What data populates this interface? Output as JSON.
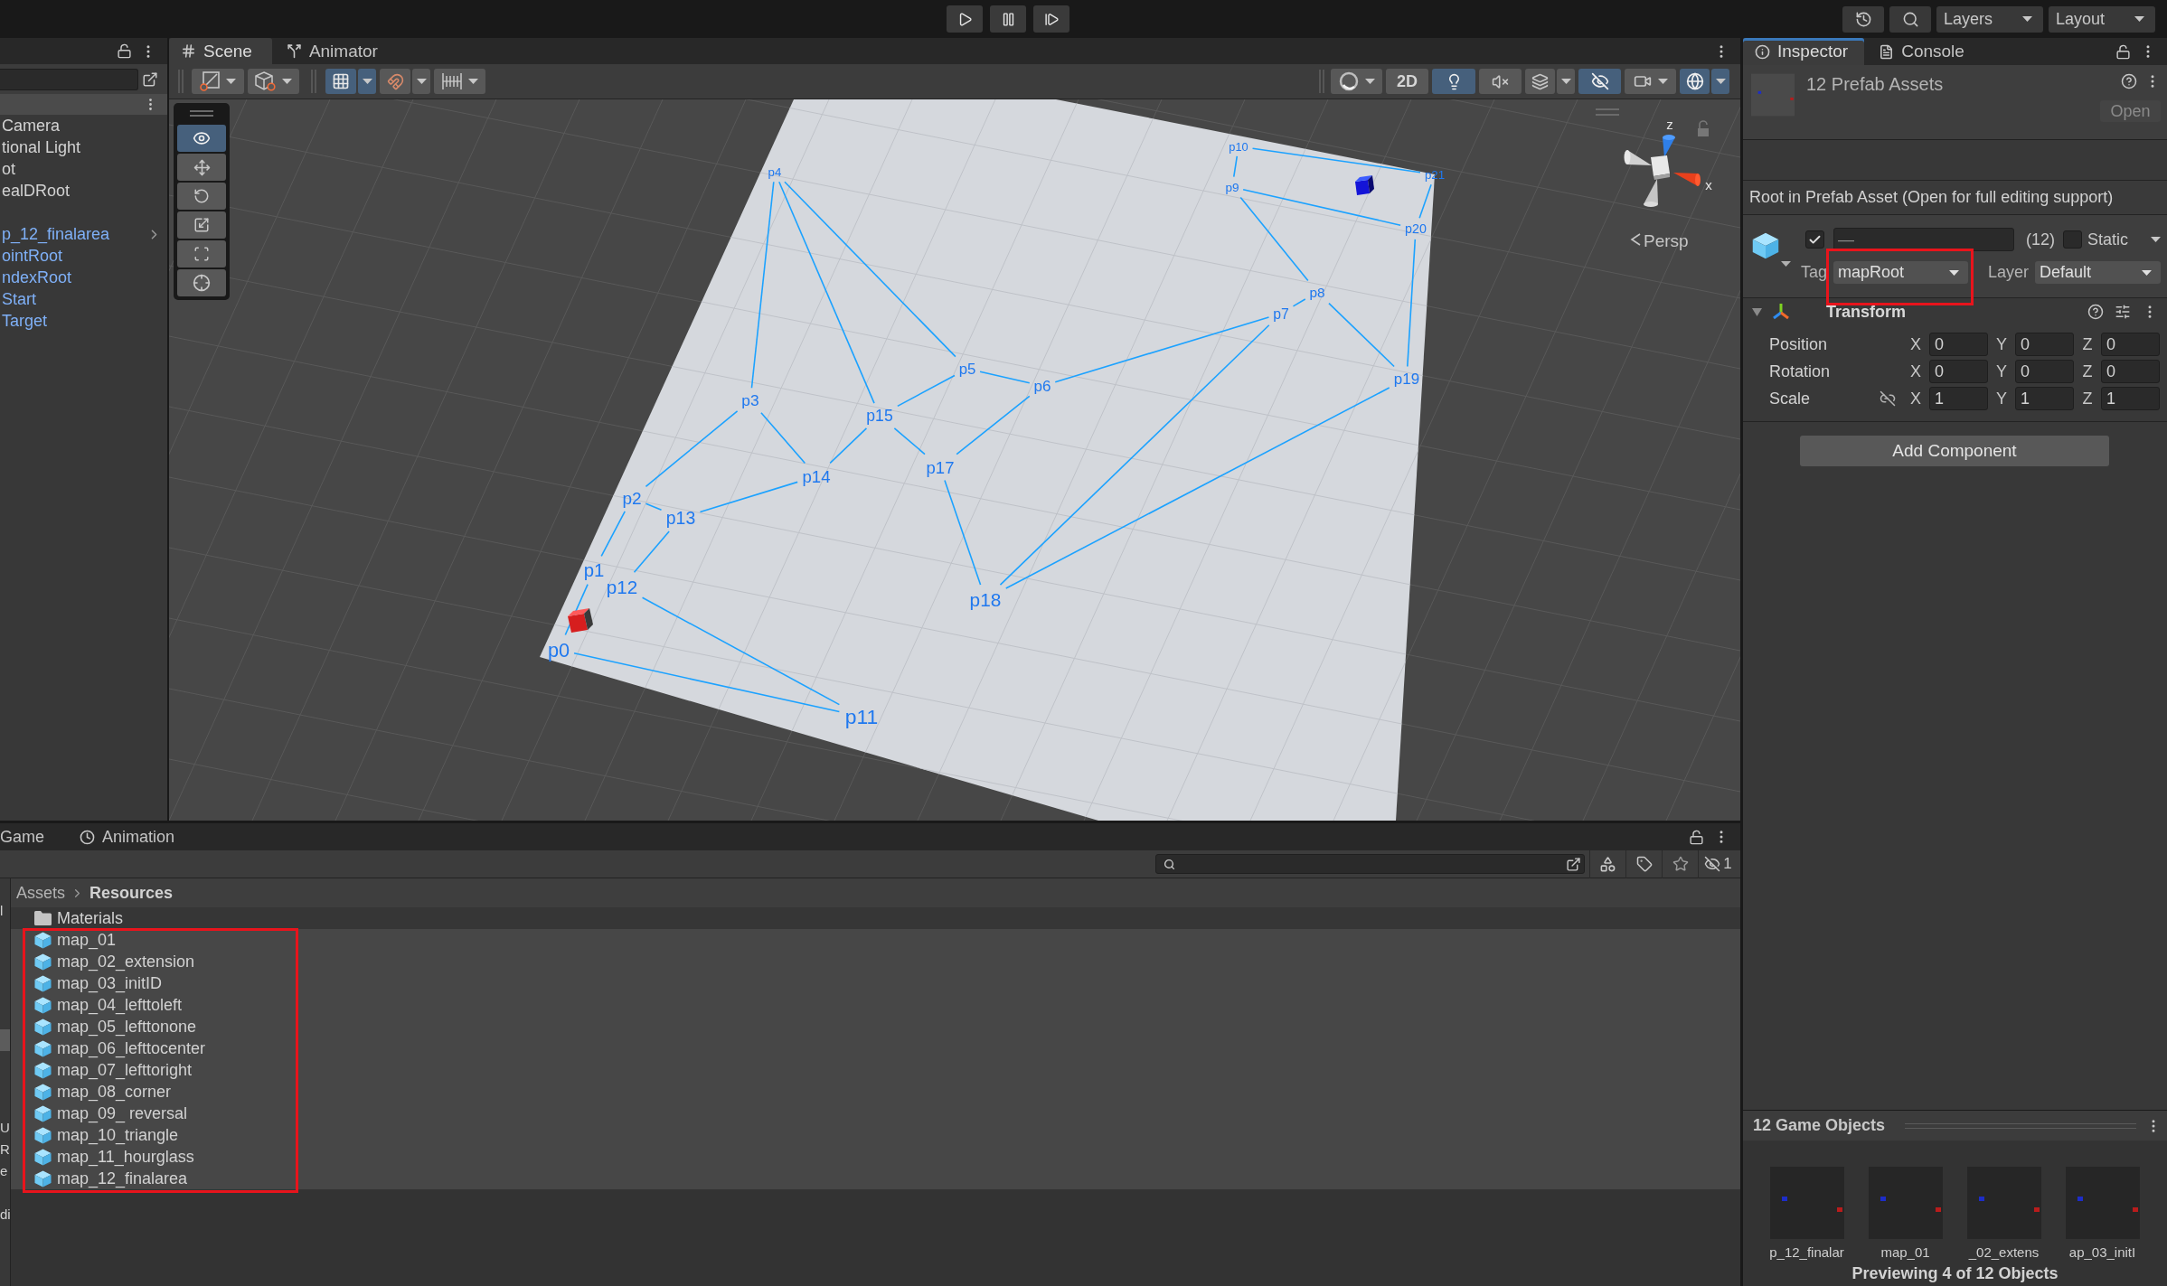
{
  "toolbar": {
    "dropdowns": [
      {
        "label": "Layers"
      },
      {
        "label": "Layout"
      }
    ]
  },
  "hierarchy": {
    "groups": [
      {
        "items": [
          {
            "label": "Camera",
            "kind": "object",
            "expandable": false
          },
          {
            "label": "tional Light",
            "kind": "object",
            "expandable": false
          },
          {
            "label": "ot",
            "kind": "object",
            "expandable": false
          },
          {
            "label": "ealDRoot",
            "kind": "object",
            "expandable": false
          }
        ]
      },
      {
        "items": [
          {
            "label": "p_12_finalarea",
            "kind": "prefab",
            "expandable": true
          },
          {
            "label": "ointRoot",
            "kind": "prefab",
            "expandable": false
          },
          {
            "label": "ndexRoot",
            "kind": "prefab",
            "expandable": false
          },
          {
            "label": "Start",
            "kind": "prefab",
            "expandable": false
          },
          {
            "label": "Target",
            "kind": "prefab",
            "expandable": false
          }
        ]
      }
    ]
  },
  "scene": {
    "tabs": [
      {
        "label": "Scene",
        "kind": "scene",
        "selected": true
      },
      {
        "label": "Animator",
        "kind": "animator",
        "selected": false
      }
    ],
    "toolbar_left": [
      [
        {
          "kind": "global",
          "on": false
        },
        {
          "kind": "pivot",
          "on": false
        }
      ],
      [
        {
          "kind": "grid",
          "on": true
        },
        {
          "kind": "snap",
          "on": false
        },
        {
          "kind": "increment",
          "on": false
        }
      ]
    ],
    "toolbar_right": [
      {
        "kind": "shading",
        "on": false
      },
      {
        "kind": "mode_2d",
        "label": "2D",
        "on": false
      },
      {
        "kind": "lighting",
        "on": true
      },
      {
        "kind": "audio",
        "on": false
      },
      {
        "kind": "effects",
        "on": false
      },
      {
        "kind": "visibility",
        "on": true
      },
      {
        "kind": "camera",
        "on": false
      },
      {
        "kind": "gizmos",
        "on": true
      }
    ],
    "tools": [
      {
        "kind": "view",
        "selected": true
      },
      {
        "kind": "move",
        "selected": false
      },
      {
        "kind": "rotate",
        "selected": false
      },
      {
        "kind": "scale",
        "selected": false
      },
      {
        "kind": "rect",
        "selected": false
      },
      {
        "kind": "transform",
        "selected": false
      }
    ],
    "nodes": [
      {
        "label": "p0"
      },
      {
        "label": "p1"
      },
      {
        "label": "p2"
      },
      {
        "label": "p3"
      },
      {
        "label": "p4"
      },
      {
        "label": "p5"
      },
      {
        "label": "p6"
      },
      {
        "label": "p7"
      },
      {
        "label": "p8"
      },
      {
        "label": "p9"
      },
      {
        "label": "p10"
      },
      {
        "label": "p11"
      },
      {
        "label": "p12"
      },
      {
        "label": "p13"
      },
      {
        "label": "p14"
      },
      {
        "label": "p15"
      },
      {
        "label": "p17"
      },
      {
        "label": "p18"
      },
      {
        "label": "p19"
      },
      {
        "label": "p20"
      },
      {
        "label": "p21"
      }
    ],
    "gizmo_axes": [
      {
        "label": "z"
      },
      {
        "label": "x"
      }
    ],
    "projection": "Persp"
  },
  "inspector": {
    "tabs": [
      {
        "label": "Inspector",
        "kind": "inspector",
        "selected": true
      },
      {
        "label": "Console",
        "kind": "console",
        "selected": false
      }
    ],
    "title": "12 Prefab Assets",
    "open_button": {
      "label": "Open",
      "disabled": true
    },
    "notice": "Root in Prefab Asset (Open for full editing support)",
    "object": {
      "active": true,
      "name": "—",
      "count": "(12)",
      "static": {
        "label": "Static",
        "checked": false
      },
      "tag": {
        "label": "Tag",
        "value": "mapRoot"
      },
      "layer": {
        "label": "Layer",
        "value": "Default"
      }
    },
    "transform": {
      "title": "Transform",
      "expanded": true,
      "rows": [
        {
          "label": "Position",
          "kind": "position",
          "fields": [
            {
              "axis": "X",
              "value": "0"
            },
            {
              "axis": "Y",
              "value": "0"
            },
            {
              "axis": "Z",
              "value": "0"
            }
          ]
        },
        {
          "label": "Rotation",
          "kind": "rotation",
          "fields": [
            {
              "axis": "X",
              "value": "0"
            },
            {
              "axis": "Y",
              "value": "0"
            },
            {
              "axis": "Z",
              "value": "0"
            }
          ]
        },
        {
          "label": "Scale",
          "kind": "scale",
          "fields": [
            {
              "axis": "X",
              "value": "1"
            },
            {
              "axis": "Y",
              "value": "1"
            },
            {
              "axis": "Z",
              "value": "1"
            }
          ]
        }
      ]
    },
    "add_component": "Add Component",
    "preview": {
      "title": "12 Game Objects",
      "items": [
        {
          "label": "p_12_finalar"
        },
        {
          "label": "map_01"
        },
        {
          "label": "_02_extens"
        },
        {
          "label": "ap_03_initI"
        }
      ],
      "caption": "Previewing 4 of 12 Objects"
    }
  },
  "project": {
    "tabs": [
      {
        "label": "Game",
        "kind": "game",
        "selected": false
      },
      {
        "label": "Animation",
        "kind": "animation",
        "selected": false
      }
    ],
    "hidden_count": "1",
    "folder_tree": [
      {
        "label": "l",
        "selected": false
      },
      {
        "selected": false
      },
      {
        "selected": false
      },
      {
        "selected": false
      },
      {
        "selected": false
      },
      {
        "selected": false
      },
      {
        "selected": true
      },
      {
        "selected": false
      },
      {
        "selected": false
      },
      {
        "selected": false
      },
      {
        "label": "U",
        "selected": false
      },
      {
        "label": "R",
        "selected": false
      },
      {
        "label": "e",
        "selected": false
      },
      {
        "selected": false
      },
      {
        "label": "di",
        "selected": false
      }
    ],
    "breadcrumb": [
      {
        "label": "Assets",
        "current": false
      },
      {
        "label": "Resources",
        "current": true
      }
    ],
    "items": [
      {
        "kind": "folder",
        "label": "Materials",
        "selected": false
      },
      {
        "kind": "prefab",
        "label": "map_01",
        "selected": true
      },
      {
        "kind": "prefab",
        "label": "map_02_extension",
        "selected": true
      },
      {
        "kind": "prefab",
        "label": "map_03_initID",
        "selected": true
      },
      {
        "kind": "prefab",
        "label": "map_04_lefttoleft",
        "selected": true
      },
      {
        "kind": "prefab",
        "label": "map_05_lefttonone",
        "selected": true
      },
      {
        "kind": "prefab",
        "label": "map_06_lefttocenter",
        "selected": true
      },
      {
        "kind": "prefab",
        "label": "map_07_lefttoright",
        "selected": true
      },
      {
        "kind": "prefab",
        "label": "map_08_corner",
        "selected": true
      },
      {
        "kind": "prefab",
        "label": "map_09_ reversal",
        "selected": true
      },
      {
        "kind": "prefab",
        "label": "map_10_triangle",
        "selected": true
      },
      {
        "kind": "prefab",
        "label": "map_11_hourglass",
        "selected": true
      },
      {
        "kind": "prefab",
        "label": "map_12_finalarea",
        "selected": true
      }
    ]
  }
}
